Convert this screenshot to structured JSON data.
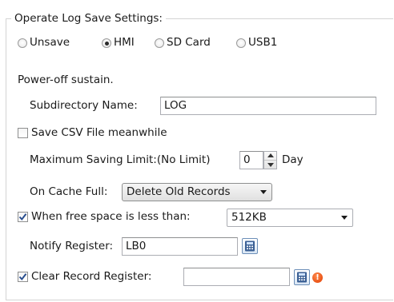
{
  "group": {
    "title": "Operate Log Save Settings:"
  },
  "save_location": {
    "options": [
      {
        "label": "Unsave",
        "checked": false
      },
      {
        "label": "HMI",
        "checked": true
      },
      {
        "label": "SD Card",
        "checked": false
      },
      {
        "label": "USB1",
        "checked": false
      }
    ]
  },
  "power_off_note": "Power-off sustain.",
  "subdirectory": {
    "label": "Subdirectory Name:",
    "value": "LOG"
  },
  "save_csv": {
    "label": "Save CSV File meanwhile",
    "checked": false
  },
  "max_saving": {
    "label": "Maximum Saving Limit:(No Limit)",
    "value": "0",
    "unit": "Day"
  },
  "cache_full": {
    "label": "On Cache Full:",
    "selected": "Delete Old Records"
  },
  "free_space": {
    "label": "When free space is less than:",
    "checked": true,
    "selected": "512KB"
  },
  "notify_register": {
    "label": "Notify Register:",
    "value": "LB0",
    "icon": "calculator-icon"
  },
  "clear_register": {
    "label": "Clear Record Register:",
    "checked": true,
    "value": "",
    "icon": "calculator-icon",
    "error_icon": "error-icon"
  },
  "colors": {
    "error": "#e03c00",
    "check": "#2a4f8f",
    "icon_border": "#6d8fb8"
  }
}
